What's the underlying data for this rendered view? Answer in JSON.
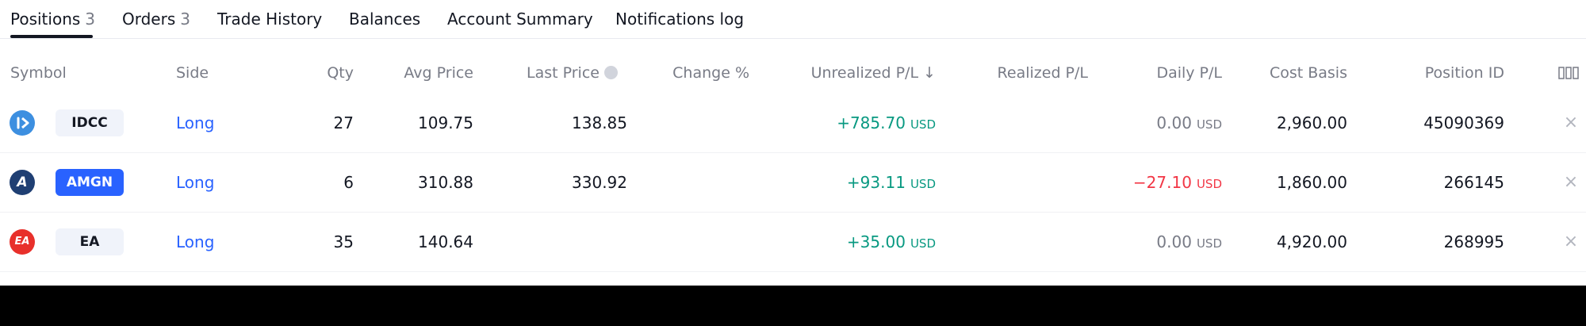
{
  "tabs": [
    {
      "label": "Positions",
      "count": "3"
    },
    {
      "label": "Orders",
      "count": "3"
    },
    {
      "label": "Trade History",
      "count": ""
    },
    {
      "label": "Balances",
      "count": ""
    },
    {
      "label": "Account Summary",
      "count": ""
    },
    {
      "label": "Notifications log",
      "count": ""
    }
  ],
  "table": {
    "headers": {
      "symbol": "Symbol",
      "side": "Side",
      "qty": "Qty",
      "avg_price": "Avg Price",
      "last_price": "Last Price",
      "change_pct": "Change %",
      "unrealized_pl": "Unrealized P/L ↓",
      "realized_pl": "Realized P/L",
      "daily_pl": "Daily P/L",
      "cost_basis": "Cost Basis",
      "position_id": "Position ID"
    },
    "rows": [
      {
        "logo_text": "",
        "logo_color": "#3d8fe0",
        "symbol": "IDCC",
        "side": "Long",
        "qty": "27",
        "avg_price": "109.75",
        "last_price": "138.85",
        "change_pct": "",
        "unrealized_pl": "+785.70",
        "unrealized_unit": "USD",
        "realized_pl": "",
        "daily_pl": "0.00",
        "daily_unit": "USD",
        "cost_basis": "2,960.00",
        "position_id": "45090369",
        "close": "×"
      },
      {
        "logo_text": "A",
        "logo_color": "#1f3f73",
        "symbol": "AMGN",
        "side": "Long",
        "qty": "6",
        "avg_price": "310.88",
        "last_price": "330.92",
        "change_pct": "",
        "unrealized_pl": "+93.11",
        "unrealized_unit": "USD",
        "realized_pl": "",
        "daily_pl": "−27.10",
        "daily_unit": "USD",
        "cost_basis": "1,860.00",
        "position_id": "266145",
        "close": "×"
      },
      {
        "logo_text": "EA",
        "logo_color": "#e8302b",
        "symbol": "EA",
        "side": "Long",
        "qty": "35",
        "avg_price": "140.64",
        "last_price": "",
        "change_pct": "",
        "unrealized_pl": "+35.00",
        "unrealized_unit": "USD",
        "realized_pl": "",
        "daily_pl": "0.00",
        "daily_unit": "USD",
        "cost_basis": "4,920.00",
        "position_id": "268995",
        "close": "×"
      }
    ]
  },
  "colors": {
    "positive": "#089981",
    "negative": "#f23645",
    "side_long": "#2962ff",
    "selected_badge_bg": "#2962ff",
    "badge_bg": "#f0f3fa"
  },
  "icons": {
    "info": "info-circle-icon",
    "column_settings": "columns-settings-icon",
    "close": "close-icon"
  }
}
